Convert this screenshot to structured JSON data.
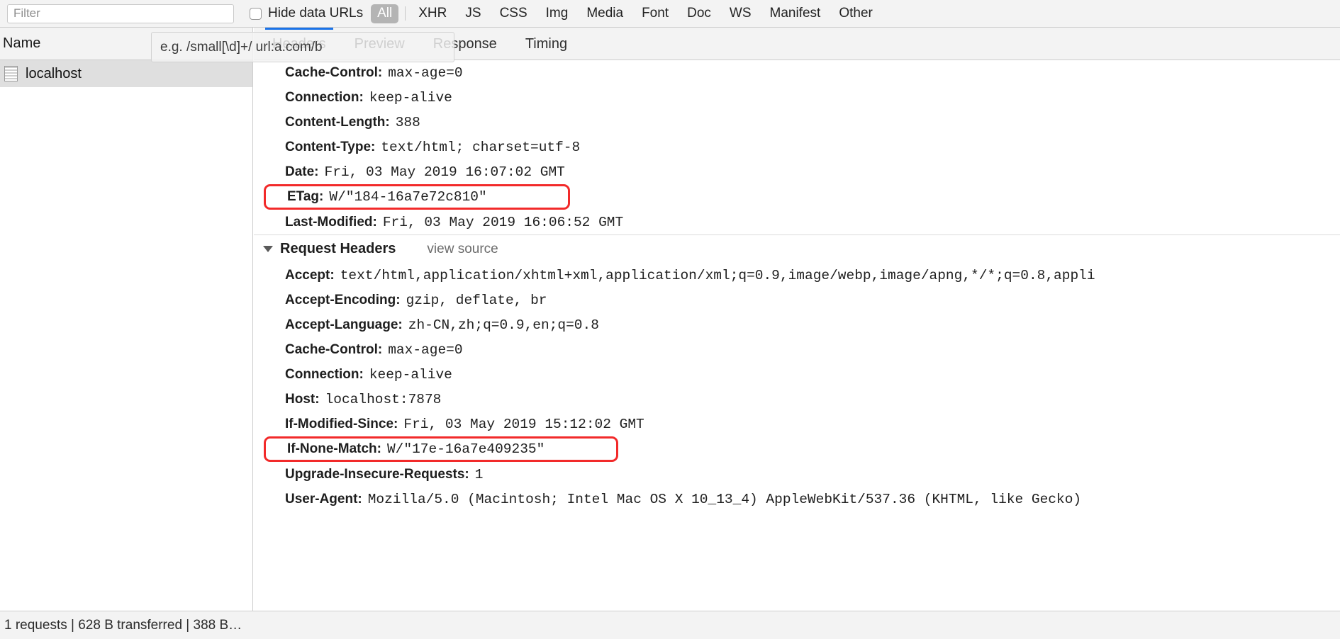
{
  "filter_bar": {
    "filter_placeholder": "Filter",
    "hide_data_urls_label": "Hide data URLs",
    "hide_data_urls_checked": false,
    "types": [
      "All",
      "XHR",
      "JS",
      "CSS",
      "Img",
      "Media",
      "Font",
      "Doc",
      "WS",
      "Manifest",
      "Other"
    ],
    "selected_type": "All",
    "selected_pill_bg": "#b4b4b4"
  },
  "tooltip": {
    "text": "e.g. /small[\\d]+/ url:a.com/b"
  },
  "left_panel": {
    "column_header": "Name",
    "rows": [
      {
        "name": "localhost",
        "icon": "document-icon",
        "selected": true
      }
    ]
  },
  "tabs": {
    "items": [
      "Headers",
      "Preview",
      "Response",
      "Timing"
    ],
    "active": "Headers",
    "active_underline_color": "#1a73e8"
  },
  "headers": {
    "response_rows": [
      {
        "key": "Cache-Control:",
        "value": "max-age=0",
        "highlight": false
      },
      {
        "key": "Connection:",
        "value": "keep-alive",
        "highlight": false
      },
      {
        "key": "Content-Length:",
        "value": "388",
        "highlight": false
      },
      {
        "key": "Content-Type:",
        "value": "text/html; charset=utf-8",
        "highlight": false
      },
      {
        "key": "Date:",
        "value": "Fri, 03 May 2019 16:07:02 GMT",
        "highlight": false
      },
      {
        "key": "ETag:",
        "value": "W/\"184-16a7e72c810\"",
        "highlight": true
      },
      {
        "key": "Last-Modified:",
        "value": "Fri, 03 May 2019 16:06:52 GMT",
        "highlight": false
      }
    ],
    "request_section": {
      "title": "Request Headers",
      "view_source_label": "view source",
      "expanded": true
    },
    "request_rows": [
      {
        "key": "Accept:",
        "value": "text/html,application/xhtml+xml,application/xml;q=0.9,image/webp,image/apng,*/*;q=0.8,appli",
        "highlight": false
      },
      {
        "key": "Accept-Encoding:",
        "value": "gzip, deflate, br",
        "highlight": false
      },
      {
        "key": "Accept-Language:",
        "value": "zh-CN,zh;q=0.9,en;q=0.8",
        "highlight": false
      },
      {
        "key": "Cache-Control:",
        "value": "max-age=0",
        "highlight": false
      },
      {
        "key": "Connection:",
        "value": "keep-alive",
        "highlight": false
      },
      {
        "key": "Host:",
        "value": "localhost:7878",
        "highlight": false
      },
      {
        "key": "If-Modified-Since:",
        "value": "Fri, 03 May 2019 15:12:02 GMT",
        "highlight": false
      },
      {
        "key": "If-None-Match:",
        "value": "W/\"17e-16a7e409235\"",
        "highlight": true
      },
      {
        "key": "Upgrade-Insecure-Requests:",
        "value": "1",
        "highlight": false
      },
      {
        "key": "User-Agent:",
        "value": "Mozilla/5.0 (Macintosh; Intel Mac OS X 10_13_4) AppleWebKit/537.36 (KHTML, like Gecko)",
        "highlight": false
      }
    ],
    "highlight_color": "#f22a2a"
  },
  "status_bar": {
    "text": "1 requests | 628 B transferred | 388 B…"
  }
}
